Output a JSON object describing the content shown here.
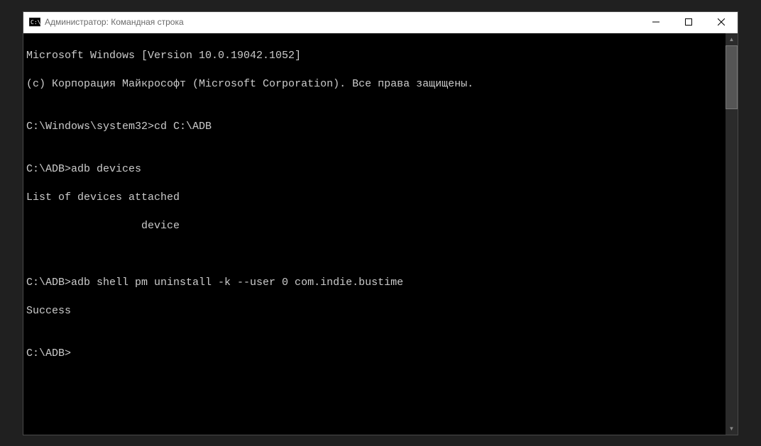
{
  "titlebar": {
    "text": "Администратор: Командная строка"
  },
  "terminal": {
    "lines": [
      "Microsoft Windows [Version 10.0.19042.1052]",
      "(c) Корпорация Майкрософт (Microsoft Corporation). Все права защищены.",
      "",
      "C:\\Windows\\system32>cd C:\\ADB",
      "",
      "C:\\ADB>adb devices",
      "List of devices attached",
      "                  device",
      "",
      "",
      "C:\\ADB>adb shell pm uninstall -k --user 0 com.indie.bustime",
      "Success",
      "",
      "C:\\ADB>"
    ]
  }
}
